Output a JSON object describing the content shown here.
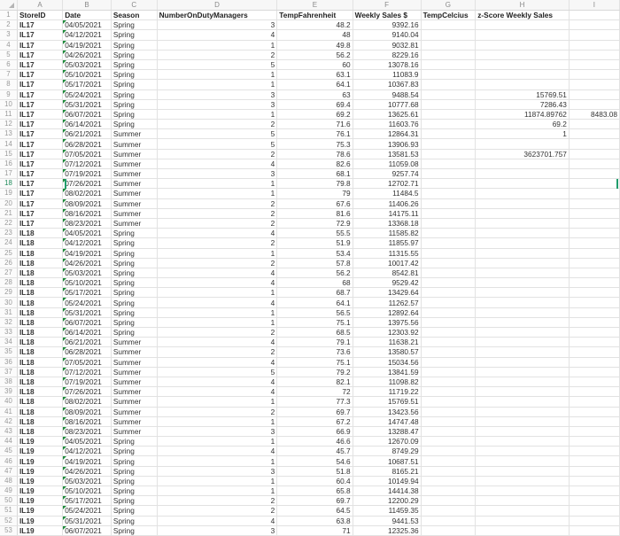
{
  "sheet": {
    "column_letters": [
      "A",
      "B",
      "C",
      "D",
      "E",
      "F",
      "G",
      "H",
      "I"
    ],
    "headers": [
      "StoreID",
      "Date",
      "Season",
      "NumberOnDutyManagers",
      "TempFahrenheit",
      "Weekly Sales $",
      "TempCelcius",
      "z-Score Weekly Sales",
      ""
    ],
    "active_row": 18,
    "date_flag_color": "#1d8a3a",
    "selection_color": "#1f9c6b",
    "rows": [
      {
        "n": 2,
        "store": "IL17",
        "date": "04/05/2021",
        "season": "Spring",
        "mgr": "3",
        "temp": "48.2",
        "sales": "9392.16",
        "g": "",
        "h": "",
        "i": ""
      },
      {
        "n": 3,
        "store": "IL17",
        "date": "04/12/2021",
        "season": "Spring",
        "mgr": "4",
        "temp": "48",
        "sales": "9140.04",
        "g": "",
        "h": "",
        "i": ""
      },
      {
        "n": 4,
        "store": "IL17",
        "date": "04/19/2021",
        "season": "Spring",
        "mgr": "1",
        "temp": "49.8",
        "sales": "9032.81",
        "g": "",
        "h": "",
        "i": ""
      },
      {
        "n": 5,
        "store": "IL17",
        "date": "04/26/2021",
        "season": "Spring",
        "mgr": "2",
        "temp": "56.2",
        "sales": "8229.16",
        "g": "",
        "h": "",
        "i": ""
      },
      {
        "n": 6,
        "store": "IL17",
        "date": "05/03/2021",
        "season": "Spring",
        "mgr": "5",
        "temp": "60",
        "sales": "13078.16",
        "g": "",
        "h": "",
        "i": ""
      },
      {
        "n": 7,
        "store": "IL17",
        "date": "05/10/2021",
        "season": "Spring",
        "mgr": "1",
        "temp": "63.1",
        "sales": "11083.9",
        "g": "",
        "h": "",
        "i": ""
      },
      {
        "n": 8,
        "store": "IL17",
        "date": "05/17/2021",
        "season": "Spring",
        "mgr": "1",
        "temp": "64.1",
        "sales": "10367.83",
        "g": "",
        "h": "",
        "i": ""
      },
      {
        "n": 9,
        "store": "IL17",
        "date": "05/24/2021",
        "season": "Spring",
        "mgr": "3",
        "temp": "63",
        "sales": "9488.54",
        "g": "",
        "h": "15769.51",
        "i": ""
      },
      {
        "n": 10,
        "store": "IL17",
        "date": "05/31/2021",
        "season": "Spring",
        "mgr": "3",
        "temp": "69.4",
        "sales": "10777.68",
        "g": "",
        "h": "7286.43",
        "i": ""
      },
      {
        "n": 11,
        "store": "IL17",
        "date": "06/07/2021",
        "season": "Spring",
        "mgr": "1",
        "temp": "69.2",
        "sales": "13625.61",
        "g": "",
        "h": "11874.89762",
        "i": "8483.08"
      },
      {
        "n": 12,
        "store": "IL17",
        "date": "06/14/2021",
        "season": "Spring",
        "mgr": "2",
        "temp": "71.6",
        "sales": "11603.76",
        "g": "",
        "h": "69.2",
        "i": ""
      },
      {
        "n": 13,
        "store": "IL17",
        "date": "06/21/2021",
        "season": "Summer",
        "mgr": "5",
        "temp": "76.1",
        "sales": "12864.31",
        "g": "",
        "h": "1",
        "i": ""
      },
      {
        "n": 14,
        "store": "IL17",
        "date": "06/28/2021",
        "season": "Summer",
        "mgr": "5",
        "temp": "75.3",
        "sales": "13906.93",
        "g": "",
        "h": "",
        "i": ""
      },
      {
        "n": 15,
        "store": "IL17",
        "date": "07/05/2021",
        "season": "Summer",
        "mgr": "2",
        "temp": "78.6",
        "sales": "13581.53",
        "g": "",
        "h": "3623701.757",
        "i": ""
      },
      {
        "n": 16,
        "store": "IL17",
        "date": "07/12/2021",
        "season": "Summer",
        "mgr": "4",
        "temp": "82.6",
        "sales": "11059.08",
        "g": "",
        "h": "",
        "i": ""
      },
      {
        "n": 17,
        "store": "IL17",
        "date": "07/19/2021",
        "season": "Summer",
        "mgr": "3",
        "temp": "68.1",
        "sales": "9257.74",
        "g": "",
        "h": "",
        "i": ""
      },
      {
        "n": 18,
        "store": "IL17",
        "date": "07/26/2021",
        "season": "Summer",
        "mgr": "1",
        "temp": "79.8",
        "sales": "12702.71",
        "g": "",
        "h": "",
        "i": ""
      },
      {
        "n": 19,
        "store": "IL17",
        "date": "08/02/2021",
        "season": "Summer",
        "mgr": "1",
        "temp": "79",
        "sales": "11484.5",
        "g": "",
        "h": "",
        "i": ""
      },
      {
        "n": 20,
        "store": "IL17",
        "date": "08/09/2021",
        "season": "Summer",
        "mgr": "2",
        "temp": "67.6",
        "sales": "11406.26",
        "g": "",
        "h": "",
        "i": ""
      },
      {
        "n": 21,
        "store": "IL17",
        "date": "08/16/2021",
        "season": "Summer",
        "mgr": "2",
        "temp": "81.6",
        "sales": "14175.11",
        "g": "",
        "h": "",
        "i": ""
      },
      {
        "n": 22,
        "store": "IL17",
        "date": "08/23/2021",
        "season": "Summer",
        "mgr": "2",
        "temp": "72.9",
        "sales": "13368.18",
        "g": "",
        "h": "",
        "i": ""
      },
      {
        "n": 23,
        "store": "IL18",
        "date": "04/05/2021",
        "season": "Spring",
        "mgr": "4",
        "temp": "55.5",
        "sales": "11585.82",
        "g": "",
        "h": "",
        "i": ""
      },
      {
        "n": 24,
        "store": "IL18",
        "date": "04/12/2021",
        "season": "Spring",
        "mgr": "2",
        "temp": "51.9",
        "sales": "11855.97",
        "g": "",
        "h": "",
        "i": ""
      },
      {
        "n": 25,
        "store": "IL18",
        "date": "04/19/2021",
        "season": "Spring",
        "mgr": "1",
        "temp": "53.4",
        "sales": "11315.55",
        "g": "",
        "h": "",
        "i": ""
      },
      {
        "n": 26,
        "store": "IL18",
        "date": "04/26/2021",
        "season": "Spring",
        "mgr": "2",
        "temp": "57.8",
        "sales": "10017.42",
        "g": "",
        "h": "",
        "i": ""
      },
      {
        "n": 27,
        "store": "IL18",
        "date": "05/03/2021",
        "season": "Spring",
        "mgr": "4",
        "temp": "56.2",
        "sales": "8542.81",
        "g": "",
        "h": "",
        "i": ""
      },
      {
        "n": 28,
        "store": "IL18",
        "date": "05/10/2021",
        "season": "Spring",
        "mgr": "4",
        "temp": "68",
        "sales": "9529.42",
        "g": "",
        "h": "",
        "i": ""
      },
      {
        "n": 29,
        "store": "IL18",
        "date": "05/17/2021",
        "season": "Spring",
        "mgr": "1",
        "temp": "68.7",
        "sales": "13429.64",
        "g": "",
        "h": "",
        "i": ""
      },
      {
        "n": 30,
        "store": "IL18",
        "date": "05/24/2021",
        "season": "Spring",
        "mgr": "4",
        "temp": "64.1",
        "sales": "11262.57",
        "g": "",
        "h": "",
        "i": ""
      },
      {
        "n": 31,
        "store": "IL18",
        "date": "05/31/2021",
        "season": "Spring",
        "mgr": "1",
        "temp": "56.5",
        "sales": "12892.64",
        "g": "",
        "h": "",
        "i": ""
      },
      {
        "n": 32,
        "store": "IL18",
        "date": "06/07/2021",
        "season": "Spring",
        "mgr": "1",
        "temp": "75.1",
        "sales": "13975.56",
        "g": "",
        "h": "",
        "i": ""
      },
      {
        "n": 33,
        "store": "IL18",
        "date": "06/14/2021",
        "season": "Spring",
        "mgr": "2",
        "temp": "68.5",
        "sales": "12303.92",
        "g": "",
        "h": "",
        "i": ""
      },
      {
        "n": 34,
        "store": "IL18",
        "date": "06/21/2021",
        "season": "Summer",
        "mgr": "4",
        "temp": "79.1",
        "sales": "11638.21",
        "g": "",
        "h": "",
        "i": ""
      },
      {
        "n": 35,
        "store": "IL18",
        "date": "06/28/2021",
        "season": "Summer",
        "mgr": "2",
        "temp": "73.6",
        "sales": "13580.57",
        "g": "",
        "h": "",
        "i": ""
      },
      {
        "n": 36,
        "store": "IL18",
        "date": "07/05/2021",
        "season": "Summer",
        "mgr": "4",
        "temp": "75.1",
        "sales": "15034.56",
        "g": "",
        "h": "",
        "i": ""
      },
      {
        "n": 37,
        "store": "IL18",
        "date": "07/12/2021",
        "season": "Summer",
        "mgr": "5",
        "temp": "79.2",
        "sales": "13841.59",
        "g": "",
        "h": "",
        "i": ""
      },
      {
        "n": 38,
        "store": "IL18",
        "date": "07/19/2021",
        "season": "Summer",
        "mgr": "4",
        "temp": "82.1",
        "sales": "11098.82",
        "g": "",
        "h": "",
        "i": ""
      },
      {
        "n": 39,
        "store": "IL18",
        "date": "07/26/2021",
        "season": "Summer",
        "mgr": "4",
        "temp": "72",
        "sales": "11719.22",
        "g": "",
        "h": "",
        "i": ""
      },
      {
        "n": 40,
        "store": "IL18",
        "date": "08/02/2021",
        "season": "Summer",
        "mgr": "1",
        "temp": "77.3",
        "sales": "15769.51",
        "g": "",
        "h": "",
        "i": ""
      },
      {
        "n": 41,
        "store": "IL18",
        "date": "08/09/2021",
        "season": "Summer",
        "mgr": "2",
        "temp": "69.7",
        "sales": "13423.56",
        "g": "",
        "h": "",
        "i": ""
      },
      {
        "n": 42,
        "store": "IL18",
        "date": "08/16/2021",
        "season": "Summer",
        "mgr": "1",
        "temp": "67.2",
        "sales": "14747.48",
        "g": "",
        "h": "",
        "i": ""
      },
      {
        "n": 43,
        "store": "IL18",
        "date": "08/23/2021",
        "season": "Summer",
        "mgr": "3",
        "temp": "66.9",
        "sales": "13288.47",
        "g": "",
        "h": "",
        "i": ""
      },
      {
        "n": 44,
        "store": "IL19",
        "date": "04/05/2021",
        "season": "Spring",
        "mgr": "1",
        "temp": "46.6",
        "sales": "12670.09",
        "g": "",
        "h": "",
        "i": ""
      },
      {
        "n": 45,
        "store": "IL19",
        "date": "04/12/2021",
        "season": "Spring",
        "mgr": "4",
        "temp": "45.7",
        "sales": "8749.29",
        "g": "",
        "h": "",
        "i": ""
      },
      {
        "n": 46,
        "store": "IL19",
        "date": "04/19/2021",
        "season": "Spring",
        "mgr": "1",
        "temp": "54.6",
        "sales": "10687.51",
        "g": "",
        "h": "",
        "i": ""
      },
      {
        "n": 47,
        "store": "IL19",
        "date": "04/26/2021",
        "season": "Spring",
        "mgr": "3",
        "temp": "51.8",
        "sales": "8165.21",
        "g": "",
        "h": "",
        "i": ""
      },
      {
        "n": 48,
        "store": "IL19",
        "date": "05/03/2021",
        "season": "Spring",
        "mgr": "1",
        "temp": "60.4",
        "sales": "10149.94",
        "g": "",
        "h": "",
        "i": ""
      },
      {
        "n": 49,
        "store": "IL19",
        "date": "05/10/2021",
        "season": "Spring",
        "mgr": "1",
        "temp": "65.8",
        "sales": "14414.38",
        "g": "",
        "h": "",
        "i": ""
      },
      {
        "n": 50,
        "store": "IL19",
        "date": "05/17/2021",
        "season": "Spring",
        "mgr": "2",
        "temp": "69.7",
        "sales": "12200.29",
        "g": "",
        "h": "",
        "i": ""
      },
      {
        "n": 51,
        "store": "IL19",
        "date": "05/24/2021",
        "season": "Spring",
        "mgr": "2",
        "temp": "64.5",
        "sales": "11459.35",
        "g": "",
        "h": "",
        "i": ""
      },
      {
        "n": 52,
        "store": "IL19",
        "date": "05/31/2021",
        "season": "Spring",
        "mgr": "4",
        "temp": "63.8",
        "sales": "9441.53",
        "g": "",
        "h": "",
        "i": ""
      },
      {
        "n": 53,
        "store": "IL19",
        "date": "06/07/2021",
        "season": "Spring",
        "mgr": "3",
        "temp": "71",
        "sales": "12325.36",
        "g": "",
        "h": "",
        "i": ""
      }
    ]
  }
}
